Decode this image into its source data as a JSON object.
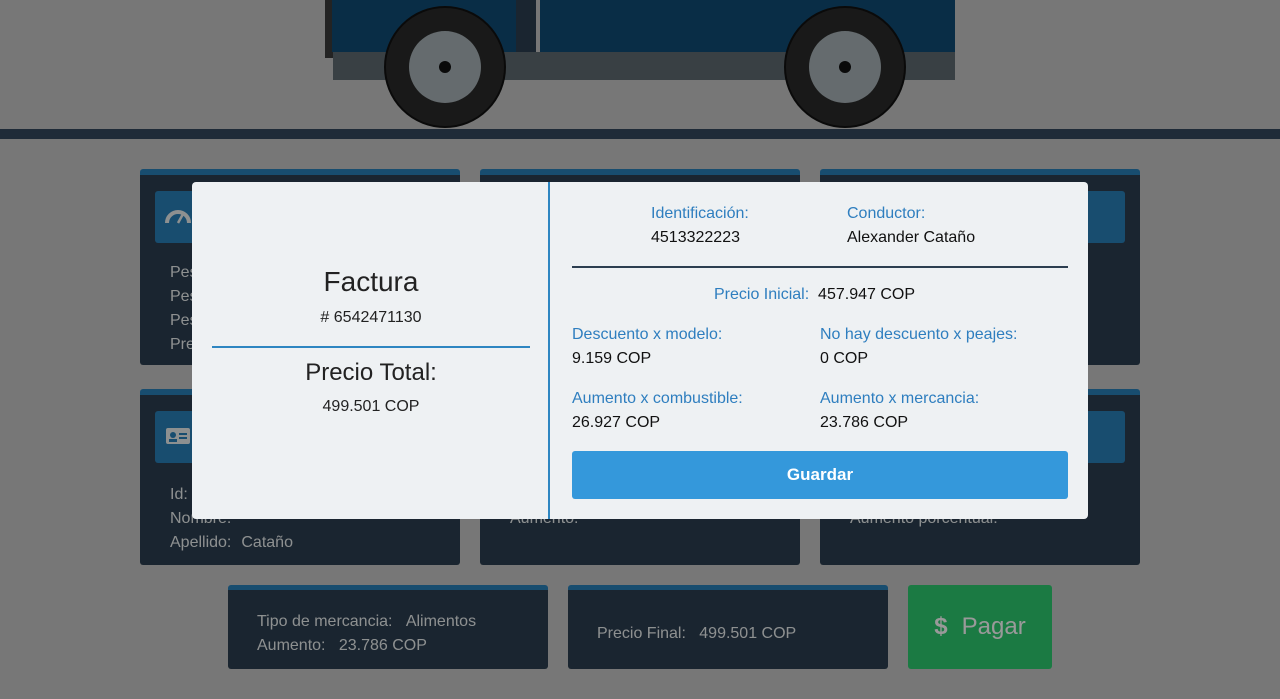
{
  "colors": {
    "page_bg": "#c7c7c7",
    "card_bg": "#2c3e50",
    "accent_blue": "#2980b9",
    "button_blue": "#3498db",
    "pay_green": "#2ecc71",
    "modal_bg": "#eef1f3"
  },
  "background": {
    "cards_row1": [
      {
        "icon": "speedometer-icon",
        "lines": [
          {
            "label": "Pes"
          },
          {
            "label": "Pes"
          },
          {
            "label": "Pes"
          },
          {
            "label": "Pre"
          }
        ]
      },
      {
        "icon": "",
        "lines": []
      },
      {
        "icon": "",
        "lines": []
      }
    ],
    "cards_row2": [
      {
        "icon": "id-card-icon",
        "lines": [
          {
            "label": "Id:"
          },
          {
            "label": "Nombre:"
          },
          {
            "label": "Apellido:",
            "value": "Cataño"
          }
        ]
      },
      {
        "lines": [
          {
            "label": "Aumento:"
          }
        ]
      },
      {
        "lines": [
          {
            "label": "Aumento porcentual:"
          }
        ]
      }
    ],
    "cargo": {
      "type_label": "Tipo de mercancia:",
      "type_value": "Alimentos",
      "increase_label": "Aumento:",
      "increase_value": "23.786 COP"
    },
    "final": {
      "label": "Precio Final:",
      "value": "499.501 COP"
    },
    "pay_button": {
      "icon": "dollar-icon",
      "glyph": "$",
      "label": "Pagar"
    }
  },
  "modal": {
    "invoice_title": "Factura",
    "invoice_number": "# 6542471130",
    "total_title": "Precio Total:",
    "total_value": "499.501 COP",
    "identification_label": "Identificación:",
    "identification_value": "4513322223",
    "driver_label": "Conductor:",
    "driver_value": "Alexander Cataño",
    "initial_price_label": "Precio Inicial:",
    "initial_price_value": "457.947 COP",
    "model_discount_label": "Descuento x modelo:",
    "model_discount_value": "9.159 COP",
    "toll_discount_label": "No hay descuento x peajes:",
    "toll_discount_value": "0 COP",
    "fuel_increase_label": "Aumento x combustible:",
    "fuel_increase_value": "26.927 COP",
    "cargo_increase_label": "Aumento x mercancia:",
    "cargo_increase_value": "23.786 COP",
    "save_button": "Guardar"
  }
}
